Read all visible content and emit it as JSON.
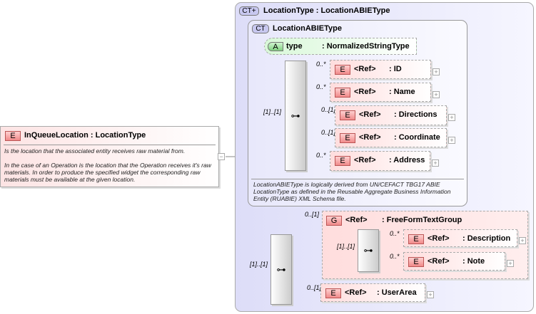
{
  "root": {
    "badge": "E",
    "title": "InQueueLocation : LocationType",
    "desc1": "Is the location that the associated entity receives raw material from.",
    "desc2": "In the case of an Operation is the location that the Operation receives it's raw materials. In order to produce the specified widget the corresponding raw materials must be available at the given location.",
    "collapse": "−"
  },
  "outer": {
    "badge": "CT+",
    "title": "LocationType : LocationABIEType"
  },
  "inner": {
    "badge": "CT",
    "title": "LocationABIEType",
    "note": "LocationABIEType is logically derived from UN/CEFACT TBG17 ABIE LocationType as defined in the Reusable Aggregate Business Information Entity (RUABIE) XML Schema file."
  },
  "attribute": {
    "badge": "A",
    "name": "type",
    "type": ": NormalizedStringType"
  },
  "seq1": {
    "cardinality": "[1]..[1]"
  },
  "elements1": [
    {
      "badge": "E",
      "ref": "<Ref>",
      "type": ": ID",
      "card": "0..*"
    },
    {
      "badge": "E",
      "ref": "<Ref>",
      "type": ": Name",
      "card": "0..*"
    },
    {
      "badge": "E",
      "ref": "<Ref>",
      "type": ": Directions",
      "card": "0..[1]"
    },
    {
      "badge": "E",
      "ref": "<Ref>",
      "type": ": Coordinate",
      "card": "0..[1]"
    },
    {
      "badge": "E",
      "ref": "<Ref>",
      "type": ": Address",
      "card": "0..*"
    }
  ],
  "seq2": {
    "cardinality": "[1]..[1]"
  },
  "group": {
    "badge": "G",
    "ref": "<Ref>",
    "type": ": FreeFormTextGroup",
    "card": "0..[1]",
    "seq_card": "[1]..[1]",
    "elements": [
      {
        "badge": "E",
        "ref": "<Ref>",
        "type": ": Description",
        "card": "0..*"
      },
      {
        "badge": "E",
        "ref": "<Ref>",
        "type": ": Note",
        "card": "0..*"
      }
    ]
  },
  "userarea": {
    "badge": "E",
    "ref": "<Ref>",
    "type": ": UserArea",
    "card": "0..[1]"
  },
  "icons": {
    "sequence": "sequence-icon",
    "expand": "+"
  }
}
